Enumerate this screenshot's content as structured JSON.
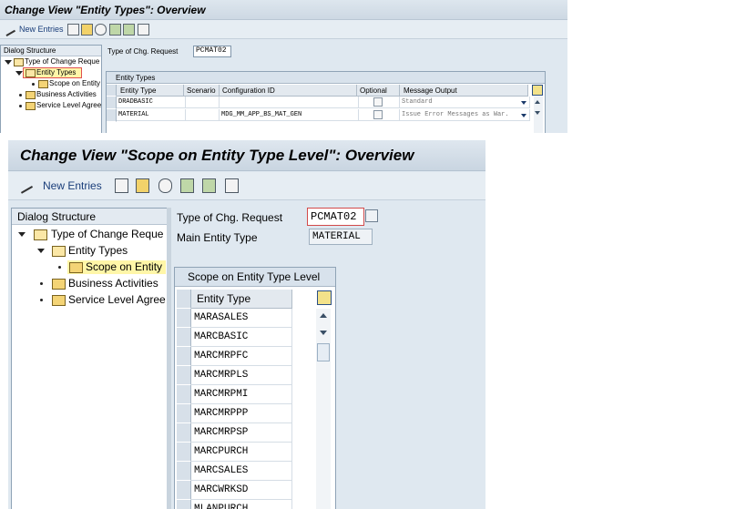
{
  "window_top": {
    "title": "Change View \"Entity Types\": Overview",
    "toolbar": {
      "new_entries": "New Entries"
    },
    "dialog_structure": {
      "header": "Dialog Structure",
      "items": [
        {
          "label": "Type of Change Reque"
        },
        {
          "label": "Entity Types"
        },
        {
          "label": "Scope on Entity"
        },
        {
          "label": "Business Activities"
        },
        {
          "label": "Service Level Agree"
        }
      ]
    },
    "fields": {
      "type_of_chg_request_label": "Type of Chg. Request",
      "type_of_chg_request_value": "PCMAT02"
    },
    "table": {
      "title": "Entity Types",
      "columns": [
        "Entity Type",
        "Scenario",
        "Configuration ID",
        "Optional",
        "Message Output"
      ],
      "rows": [
        {
          "entity_type": "DRADBASIC",
          "scenario": "",
          "config_id": "",
          "optional": false,
          "message_output": "Standard"
        },
        {
          "entity_type": "MATERIAL",
          "scenario": "",
          "config_id": "MDG_MM_APP_BS_MAT_GEN",
          "optional": false,
          "message_output": "Issue Error Messages as War."
        }
      ]
    }
  },
  "window_main": {
    "title": "Change View \"Scope on Entity Type Level\": Overview",
    "toolbar": {
      "new_entries": "New Entries"
    },
    "dialog_structure": {
      "header": "Dialog Structure",
      "items": [
        {
          "label": "Type of Change Reque"
        },
        {
          "label": "Entity Types"
        },
        {
          "label": "Scope on Entity"
        },
        {
          "label": "Business Activities"
        },
        {
          "label": "Service Level Agree"
        }
      ]
    },
    "fields": {
      "type_of_chg_request_label": "Type of Chg. Request",
      "type_of_chg_request_value": "PCMAT02",
      "main_entity_type_label": "Main Entity Type",
      "main_entity_type_value": "MATERIAL"
    },
    "table": {
      "title": "Scope on Entity Type Level",
      "column": "Entity Type",
      "rows": [
        "MARASALES",
        "MARCBASIC",
        "MARCMRPFC",
        "MARCMRPLS",
        "MARCMRPMI",
        "MARCMRPPP",
        "MARCMRPSP",
        "MARCPURCH",
        "MARCSALES",
        "MARCWRKSD",
        "MLANPURCH"
      ]
    }
  }
}
